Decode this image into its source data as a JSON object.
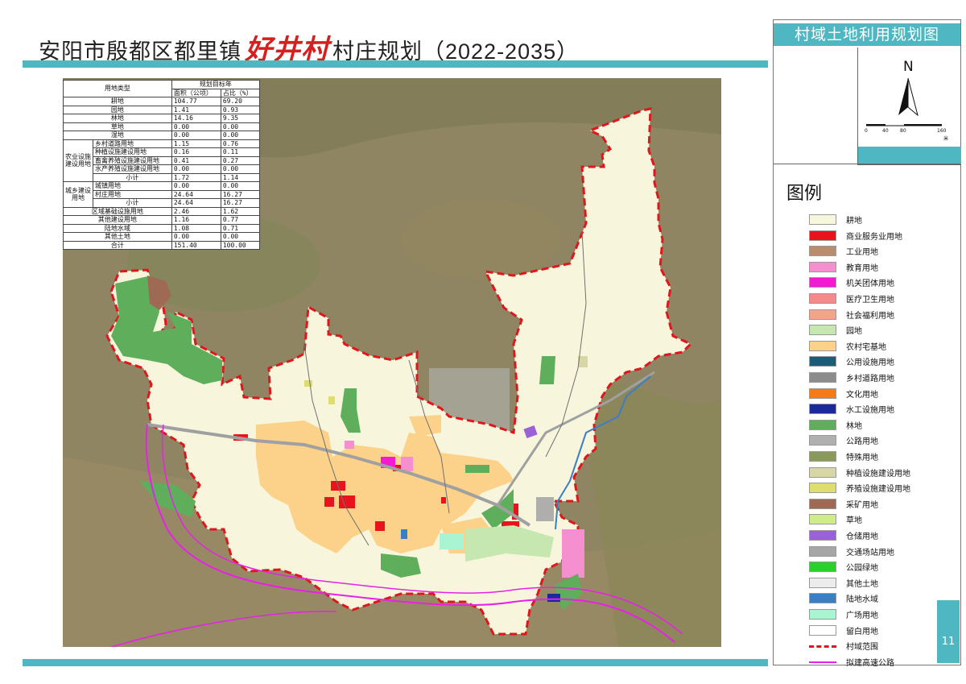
{
  "header": {
    "prefix": "安阳市殷都区都里镇",
    "village": "好井村",
    "suffix": "村庄规划",
    "years": "（2022-2035）"
  },
  "panel": {
    "title": "村域土地利用规划图",
    "north": "N",
    "scale_ticks": [
      "0",
      "40",
      "80",
      "160"
    ],
    "scale_unit": "米"
  },
  "table": {
    "head_type": "用地类型",
    "head_target": "规划目标年",
    "head_area": "面积（公顷）",
    "head_ratio": "占比（%）",
    "group_agri": "农业设施建设用地",
    "group_urban": "城乡建设用地",
    "rows": [
      {
        "name": "耕地",
        "area": "104.77",
        "ratio": "69.20"
      },
      {
        "name": "园地",
        "area": "1.41",
        "ratio": "0.93"
      },
      {
        "name": "林地",
        "area": "14.16",
        "ratio": "9.35"
      },
      {
        "name": "草地",
        "area": "0.00",
        "ratio": "0.00"
      },
      {
        "name": "湿地",
        "area": "0.00",
        "ratio": "0.00"
      },
      {
        "name": "乡村道路用地",
        "area": "1.15",
        "ratio": "0.76"
      },
      {
        "name": "种植设施建设用地",
        "area": "0.16",
        "ratio": "0.11"
      },
      {
        "name": "畜禽养殖设施建设用地",
        "area": "0.41",
        "ratio": "0.27"
      },
      {
        "name": "水产养殖设施建设用地",
        "area": "0.00",
        "ratio": "0.00"
      },
      {
        "name": "小计",
        "area": "1.72",
        "ratio": "1.14"
      },
      {
        "name": "城镇用地",
        "area": "0.00",
        "ratio": "0.00"
      },
      {
        "name": "村庄用地",
        "area": "24.64",
        "ratio": "16.27"
      },
      {
        "name": "小计",
        "area": "24.64",
        "ratio": "16.27"
      },
      {
        "name": "区域基础设施用地",
        "area": "2.46",
        "ratio": "1.62"
      },
      {
        "name": "其他建设用地",
        "area": "1.16",
        "ratio": "0.77"
      },
      {
        "name": "陆地水域",
        "area": "1.08",
        "ratio": "0.71"
      },
      {
        "name": "其他土地",
        "area": "0.00",
        "ratio": "0.00"
      },
      {
        "name": "合计",
        "area": "151.40",
        "ratio": "100.00"
      }
    ]
  },
  "legend": {
    "heading": "图例",
    "items": [
      {
        "label": "耕地",
        "color": "#f7f7de"
      },
      {
        "label": "商业服务业用地",
        "color": "#e8131c"
      },
      {
        "label": "工业用地",
        "color": "#b98c6e"
      },
      {
        "label": "教育用地",
        "color": "#f58fcf"
      },
      {
        "label": "机关团体用地",
        "color": "#f31bd0"
      },
      {
        "label": "医疗卫生用地",
        "color": "#f58a8a"
      },
      {
        "label": "社会福利用地",
        "color": "#f4a589"
      },
      {
        "label": "园地",
        "color": "#c6e8b0"
      },
      {
        "label": "农村宅基地",
        "color": "#fcd28a"
      },
      {
        "label": "公用设施用地",
        "color": "#1c5c78"
      },
      {
        "label": "乡村道路用地",
        "color": "#8c8c8c"
      },
      {
        "label": "文化用地",
        "color": "#f57b16"
      },
      {
        "label": "水工设施用地",
        "color": "#1a2a9a"
      },
      {
        "label": "林地",
        "color": "#5fae5c"
      },
      {
        "label": "公路用地",
        "color": "#b0b0b0"
      },
      {
        "label": "特殊用地",
        "color": "#8a9a5a"
      },
      {
        "label": "种植设施建设用地",
        "color": "#d6d6a6"
      },
      {
        "label": "养殖设施建设用地",
        "color": "#dede6e"
      },
      {
        "label": "采矿用地",
        "color": "#9e6a54"
      },
      {
        "label": "草地",
        "color": "#cfeb8a"
      },
      {
        "label": "仓储用地",
        "color": "#9a62d6"
      },
      {
        "label": "交通场站用地",
        "color": "#a6a6a6"
      },
      {
        "label": "公园绿地",
        "color": "#2ad12a"
      },
      {
        "label": "其他土地",
        "color": "#ececec"
      },
      {
        "label": "陆地水域",
        "color": "#3a7fc4"
      },
      {
        "label": "广场用地",
        "color": "#a9f5d2"
      },
      {
        "label": "留白用地",
        "color": "#ffffff"
      },
      {
        "label": "村域范围",
        "color": "#e0161c"
      },
      {
        "label": "拟建高速公路",
        "color": "#e820e8"
      }
    ]
  },
  "page_number": "11"
}
